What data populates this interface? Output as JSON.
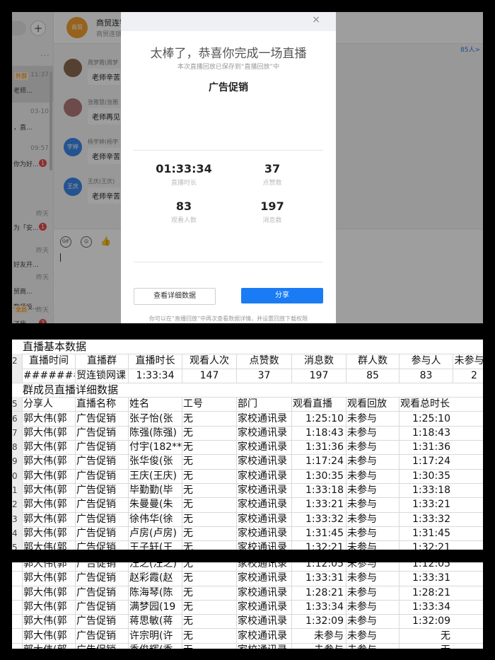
{
  "chat": {
    "plus_label": "+",
    "more_dots": "...",
    "conversations": [
      {
        "tag": "外部",
        "time": "11:37",
        "snippet": "老师...",
        "badge": "",
        "selected": true
      },
      {
        "tag": "",
        "time": "03-10",
        "snippet": "，直...",
        "badge": "",
        "selected": false
      },
      {
        "tag": "",
        "time": "09:57",
        "snippet": "你为好...",
        "badge": "1",
        "selected": false
      },
      {
        "tag": "",
        "time": "昨天",
        "snippet": "为「安...",
        "badge": "1",
        "selected": false
      },
      {
        "tag": "",
        "time": "昨天",
        "snippet": "好友开...",
        "badge": "",
        "selected": false
      },
      {
        "tag": "",
        "time": "昨天",
        "snippet": "贸商...",
        "badge": "",
        "selected": false
      },
      {
        "tag": "",
        "time": "",
        "snippet": "教师投...",
        "badge": "",
        "selected": false
      },
      {
        "tag": "全员",
        "time": "昨天",
        "snippet": "了我...",
        "badge": "2",
        "selected": false
      }
    ],
    "group_avatar_text": "商贸",
    "group_name": "商贸连锁",
    "group_sub": "商贸连锁",
    "right_link": "85人>",
    "messages": [
      {
        "avatar": "",
        "name": "周梦霞(周梦",
        "text": "老师辛苦",
        "color": "#8a6a50"
      },
      {
        "avatar": "",
        "name": "张雅慧(张雅",
        "text": "老师再见",
        "color": "#b07a7a"
      },
      {
        "avatar": "宇婷",
        "name": "杨宇婷(杨宇",
        "text": "老师辛苦",
        "color": "#3a86e8"
      },
      {
        "avatar": "王庆",
        "name": "王庆(王庆)",
        "text": "老师辛苦",
        "color": "#3a86e8"
      }
    ],
    "tool_gif": "GIF"
  },
  "modal": {
    "close_icon": "×",
    "title": "太棒了，恭喜你完成一场直播",
    "subtitle": "本次直播回放已保存到“直播回放”中",
    "live_name": "广告促销",
    "stats": [
      {
        "value": "01:33:34",
        "label": "直播时长"
      },
      {
        "value": "37",
        "label": "点赞数"
      },
      {
        "value": "83",
        "label": "观看人数"
      },
      {
        "value": "197",
        "label": "消息数"
      }
    ],
    "btn_detail": "查看详细数据",
    "btn_share": "分享",
    "footer": "你可以在“直播回放”中再次查看数据详情，并设置回放下载权限"
  },
  "sheet1": {
    "section_title": "直播基本数据",
    "headers": [
      "直播时间",
      "直播群",
      "直播时长",
      "观看人次",
      "点赞数",
      "消息数",
      "群人数",
      "参与人",
      "未参与人"
    ],
    "summary_row": [
      "#######",
      "贸连锁网课",
      "1:33:34",
      "147",
      "37",
      "197",
      "85",
      "83",
      "2"
    ],
    "section2_title": "群成员直播详细数据",
    "detail_headers": [
      "分享人",
      "直播名称",
      "姓名",
      "工号",
      "部门",
      "观看直播",
      "观看回放",
      "观看总时长"
    ],
    "rows": [
      [
        "郭大伟(郭",
        "广告促销",
        "张子怡(张",
        "无",
        "家校通讯录",
        "1:25:10",
        "未参与",
        "1:25:10"
      ],
      [
        "郭大伟(郭",
        "广告促销",
        "陈强(陈强)",
        "无",
        "家校通讯录",
        "1:18:43",
        "未参与",
        "1:18:43"
      ],
      [
        "郭大伟(郭",
        "广告促销",
        "付宇(182**",
        "无",
        "家校通讯录",
        "1:31:36",
        "未参与",
        "1:31:36"
      ],
      [
        "郭大伟(郭",
        "广告促销",
        "张华俊(张",
        "无",
        "家校通讯录",
        "1:17:24",
        "未参与",
        "1:17:24"
      ],
      [
        "郭大伟(郭",
        "广告促销",
        "王庆(王庆)",
        "无",
        "家校通讯录",
        "1:30:35",
        "未参与",
        "1:30:35"
      ],
      [
        "郭大伟(郭",
        "广告促销",
        "毕勤勤(毕",
        "无",
        "家校通讯录",
        "1:33:18",
        "未参与",
        "1:33:18"
      ],
      [
        "郭大伟(郭",
        "广告促销",
        "朱曼曼(朱",
        "无",
        "家校通讯录",
        "1:33:21",
        "未参与",
        "1:33:21"
      ],
      [
        "郭大伟(郭",
        "广告促销",
        "徐伟华(徐",
        "无",
        "家校通讯录",
        "1:33:32",
        "未参与",
        "1:33:32"
      ],
      [
        "郭大伟(郭",
        "广告促销",
        "卢房(卢房)",
        "无",
        "家校通讯录",
        "1:31:45",
        "未参与",
        "1:31:45"
      ],
      [
        "郭大伟(郭",
        "广告促销",
        "王子轩(王",
        "无",
        "家校通讯录",
        "1:32:21",
        "未参与",
        "1:32:21"
      ]
    ],
    "row_numbers": [
      "",
      "2",
      "",
      "",
      "5",
      "6",
      "7",
      "8",
      "9",
      "0",
      "1",
      "2",
      "3",
      "4",
      "5"
    ]
  },
  "sheet2": {
    "rows": [
      [
        "郭大伟(郭",
        "广告促销",
        "汪之(汪之)",
        "无",
        "家校通讯录",
        "1:12:05",
        "未参与",
        "1:12:05"
      ],
      [
        "郭大伟(郭",
        "广告促销",
        "赵彩霞(赵",
        "无",
        "家校通讯录",
        "1:33:31",
        "未参与",
        "1:33:31"
      ],
      [
        "郭大伟(郭",
        "广告促销",
        "陈海琴(陈",
        "无",
        "家校通讯录",
        "1:28:21",
        "未参与",
        "1:28:21"
      ],
      [
        "郭大伟(郭",
        "广告促销",
        "满梦园(19",
        "无",
        "家校通讯录",
        "1:33:34",
        "未参与",
        "1:33:34"
      ],
      [
        "郭大伟(郭",
        "广告促销",
        "蒋思敏(蒋",
        "无",
        "家校通讯录",
        "1:32:09",
        "未参与",
        "1:32:09"
      ],
      [
        "郭大伟(郭",
        "广告促销",
        "许宗明(许",
        "无",
        "家校通讯录",
        "未参与",
        "未参与",
        "无"
      ],
      [
        "郭大伟(郭",
        "广告促销",
        "季俊辉(季",
        "无",
        "家校通讯录",
        "未参与",
        "未参与",
        "无"
      ]
    ]
  }
}
